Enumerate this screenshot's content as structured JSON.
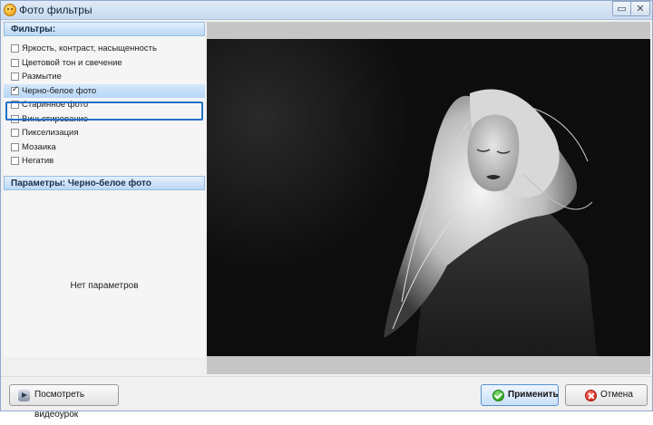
{
  "window": {
    "title": "Фото фильтры",
    "maximize_glyph": "▭",
    "close_glyph": "✕",
    "app_icon": "smiley-app-icon"
  },
  "filters_panel": {
    "header": "Фильтры:",
    "items": [
      {
        "label": "Яркость, контраст, насыщенность",
        "checked": false
      },
      {
        "label": "Цветовой тон и свечение",
        "checked": false
      },
      {
        "label": "Размытие",
        "checked": false
      },
      {
        "label": "Черно-белое фото",
        "checked": true
      },
      {
        "label": "Старинное фото",
        "checked": false
      },
      {
        "label": "Виньетирование",
        "checked": false
      },
      {
        "label": "Пикселизация",
        "checked": false
      },
      {
        "label": "Мозаика",
        "checked": false
      },
      {
        "label": "Негатив",
        "checked": false
      }
    ],
    "check_glyph": "✓"
  },
  "params_panel": {
    "header": "Параметры: Черно-белое фото",
    "empty_text": "Нет параметров"
  },
  "preview": {
    "icon": "bw-photo-preview"
  },
  "buttons": {
    "video": "Посмотреть видеоурок",
    "apply": "Применить",
    "cancel": "Отмена"
  },
  "colors": {
    "accent": "#2371c4",
    "header_bg": "#b9d7f5",
    "apply_icon": "#2ea51c",
    "cancel_icon": "#d8261a"
  }
}
